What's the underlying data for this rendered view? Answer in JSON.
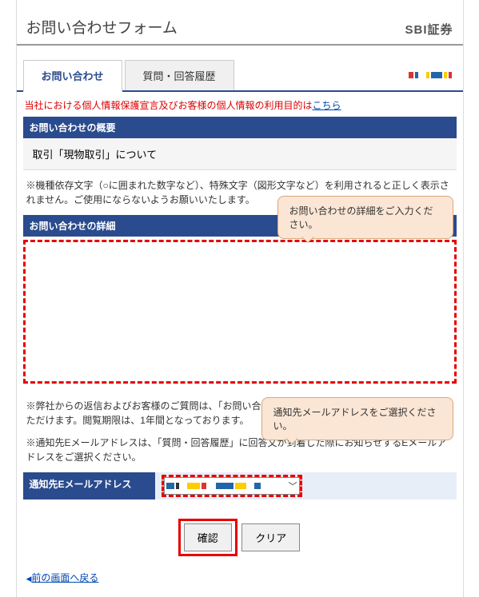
{
  "header": {
    "title": "お問い合わせフォーム",
    "brand": "SBI証券"
  },
  "tabs": {
    "active": "お問い合わせ",
    "inactive": "質問・回答履歴"
  },
  "privacy": {
    "text": "当社における個人情報保護宣言及びお客様の個人情報の利用目的は",
    "link": "こちら"
  },
  "summary": {
    "header": "お問い合わせの概要",
    "subject": "取引「現物取引」について"
  },
  "warning": "※機種依存文字（○に囲まれた数字など）、特殊文字（図形文字など）を利用されると正しく表示されません。ご使用にならないようお願いいたします。",
  "detail": {
    "header": "お問い合わせの詳細",
    "value": ""
  },
  "callouts": {
    "detail": "お問い合わせの詳細をご入力ください。",
    "email": "通知先メールアドレスをご選択ください。"
  },
  "reply_note1": "※弊社からの返信およびお客様のご質問は、「お問い合わせフォーム」の質問・回答履歴からご覧いただけます。閲覧期限は、1年間となっております。",
  "reply_note2": "※通知先Eメールアドレスは、「質問・回答履歴」に回答文が到着した際にお知らせするEメールアドレスをご選択ください。",
  "email": {
    "label": "通知先Eメールアドレス",
    "selected": ""
  },
  "buttons": {
    "confirm": "確認",
    "clear": "クリア"
  },
  "back": {
    "arrow": "◀",
    "text": "前の画面へ戻る"
  }
}
